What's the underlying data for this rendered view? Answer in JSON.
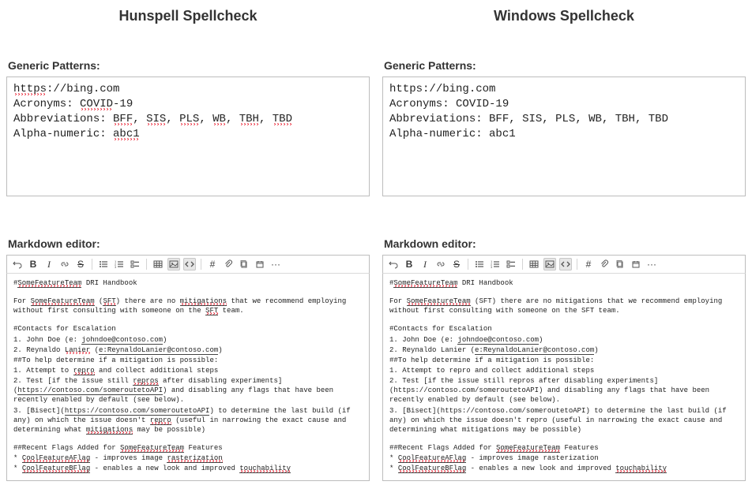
{
  "left_title": "Hunspell Spellcheck",
  "right_title": "Windows Spellcheck",
  "generic_heading": "Generic Patterns:",
  "markdown_heading": "Markdown editor:",
  "generic": {
    "url_plain": "://bing.com",
    "url_scheme": "https",
    "acronyms_label": "Acronyms: ",
    "acronym_word": "COVID",
    "acronym_suffix": "-19",
    "abbr_label": "Abbreviations: ",
    "abbr_list": [
      "BFF",
      "SIS",
      "PLS",
      "WB",
      "TBH",
      "TBD"
    ],
    "alnum_label": "Alpha-numeric: ",
    "alnum_word": "abc1"
  },
  "toolbar": {
    "bold": "B",
    "italic": "I",
    "strike": "S",
    "hash": "#",
    "ellipsis": "···"
  },
  "md": {
    "h_title_pre": "#",
    "h_title_sft": "SomeFeatureTeam",
    "h_title_post": " DRI Handbook",
    "p1_pre": "For ",
    "p1_sft": "SomeFeatureTeam",
    "p1_mid1": " (",
    "p1_sft_abbr": "SFT",
    "p1_mid2": ") there are no ",
    "p1_mit": "mitigations",
    "p1_mid3": " that we recommend employing without first consulting with someone on the ",
    "p1_sft_abbr2": "SFT",
    "p1_end": " team.",
    "h_contacts": "#Contacts for Escalation",
    "c1_pre": "1. John Doe (e: ",
    "c1_mail": "johndoe@contoso.com",
    "c1_post": ")",
    "c2_pre": "2. Reynaldo ",
    "c2_last": "Lanier",
    "c2_mid": " (",
    "c2_eprefix": "e:ReynaldoLanier@contoso.com",
    "c2_post": ")",
    "h_help": "##To help determine if a mitigation is possible:",
    "s1_pre": "1. Attempt to ",
    "s1_repro": "repro",
    "s1_post": " and collect additional steps",
    "s2_pre": "2. Test [if the issue still ",
    "s2_repros": "repros",
    "s2_mid": " after disabling experiments](",
    "s2_url": "https://contoso.com/someroutetoAPI",
    "s2_post": ") and disabling any flags that have been recently enabled by default (see below).",
    "s3_pre": "3. [Bisect](",
    "s3_url": "https://contoso.com/someroutetoAPI",
    "s3_mid": ") to determine the last build (if any) on which the issue doesn't ",
    "s3_repro": "repro",
    "s3_mid2": " (useful in narrowing the exact cause and determining what ",
    "s3_mit": "mitigations",
    "s3_post": " may be possible)",
    "h_flags_pre": "##Recent Flags Added for ",
    "h_flags_sft": "SomeFeatureTeam",
    "h_flags_post": " Features",
    "f1_pre": "* ",
    "f1_name": "CoolFeatureAFlag",
    "f1_mid": " - improves image ",
    "f1_rast": "rasterization",
    "f2_pre": "* ",
    "f2_name": "CoolFeatureBFlag",
    "f2_mid": " - enables a new look and improved ",
    "f2_touch": "touchability",
    "win_p1_mid2": ") there are no mitigations that we recommend employing without first consulting with someone on the SFT team.",
    "win_s1": "1. Attempt to repro and collect additional steps",
    "win_s2": "2. Test [if the issue still repros after disabling experiments](https://contoso.com/someroutetoAPI) and disabling any flags that have been recently enabled by default (see below).",
    "win_s3": "3. [Bisect](https://contoso.com/someroutetoAPI) to determine the last build (if any) on which the issue doesn't repro (useful in narrowing the exact cause and determining what mitigations may be possible)",
    "win_f1_post": " - improves image rasterization"
  }
}
